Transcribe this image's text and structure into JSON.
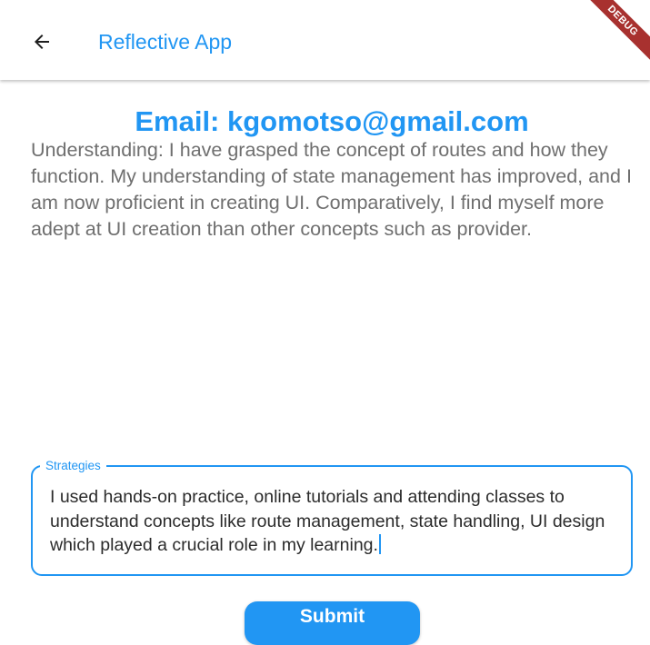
{
  "appbar": {
    "title": "Reflective App",
    "back_icon": "arrow-left-icon",
    "debug_banner": "DEBUG"
  },
  "content": {
    "email_heading": "Email: kgomotso@gmail.com",
    "reflection": "Understanding: I have grasped the concept of routes and how they function. My understanding of state management has improved, and I am now proficient in creating UI. Comparatively, I find myself more adept at UI creation than other concepts such as provider."
  },
  "strategies_field": {
    "label": "Strategies",
    "value": " I used hands-on practice, online tutorials and attending classes to understand concepts like route management, state handling, UI design which played a crucial role in my learning."
  },
  "submit_button": {
    "label": "Submit"
  },
  "colors": {
    "primary": "#2196F3",
    "debug_banner": "#A8312F",
    "body_text": "#6f6f6f"
  }
}
